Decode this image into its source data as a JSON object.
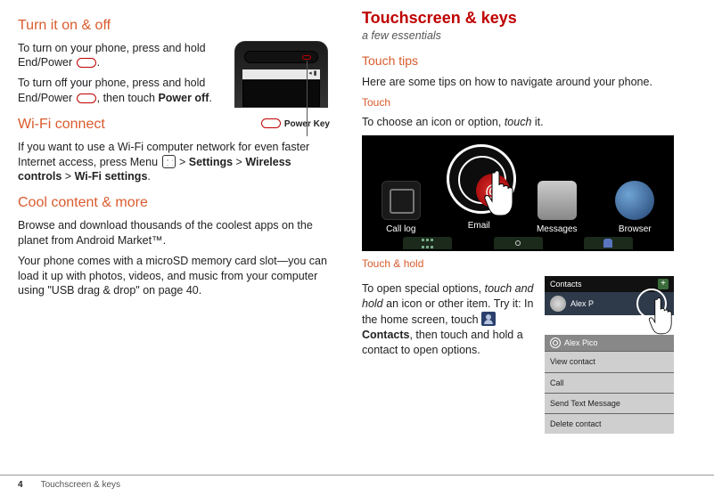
{
  "left": {
    "h_turn": "Turn it on & off",
    "turn_on_a": "To turn on your phone, press and hold End/Power ",
    "turn_on_b": ".",
    "turn_off_a": "To turn off your phone, press and hold End/Power ",
    "turn_off_b": ", then touch ",
    "power_off": "Power off",
    "turn_off_c": ".",
    "power_key_label": "Power Key",
    "h_wifi": "Wi-Fi connect",
    "wifi_a": "If you want to use a Wi-Fi computer network for even faster Internet access, press Menu ",
    "wifi_b": " > ",
    "wifi_settings": "Settings",
    "wifi_c": " > ",
    "wifi_wireless": "Wireless controls",
    "wifi_d": " > ",
    "wifi_wifi": "Wi-Fi settings",
    "wifi_e": ".",
    "h_cool": "Cool content & more",
    "cool_p1": "Browse and download thousands of the coolest apps on the planet from Android Market™.",
    "cool_p2": "Your phone comes with a microSD memory card slot—you can load it up with photos, videos, and music from your computer using \"USB drag & drop\" on page 40."
  },
  "right": {
    "h_main": "Touchscreen & keys",
    "subtitle": "a few essentials",
    "h_tips": "Touch tips",
    "tips_p": "Here are some tips on how to navigate around your phone.",
    "h_touch": "Touch",
    "touch_p_a": "To choose an icon or option, ",
    "touch_em": "touch",
    "touch_p_b": " it.",
    "apps": {
      "call": "Call log",
      "email": "Email",
      "msg": "Messages",
      "browser": "Browser"
    },
    "email_badge": "@",
    "h_hold": "Touch & hold",
    "hold_a": "To open special options, ",
    "hold_em": "touch and hold",
    "hold_b": " an icon or other item. Try it: In the home screen, touch ",
    "hold_contacts": "Contacts",
    "hold_c": ", then touch and hold a contact to open options.",
    "contacts_header": "Contacts",
    "contact_name_row": "Alex P",
    "menu_title": "Alex Pico",
    "menu_items": [
      "View contact",
      "Call",
      "Send Text Message",
      "Delete contact"
    ]
  },
  "footer": {
    "page": "4",
    "section": "Touchscreen & keys"
  }
}
